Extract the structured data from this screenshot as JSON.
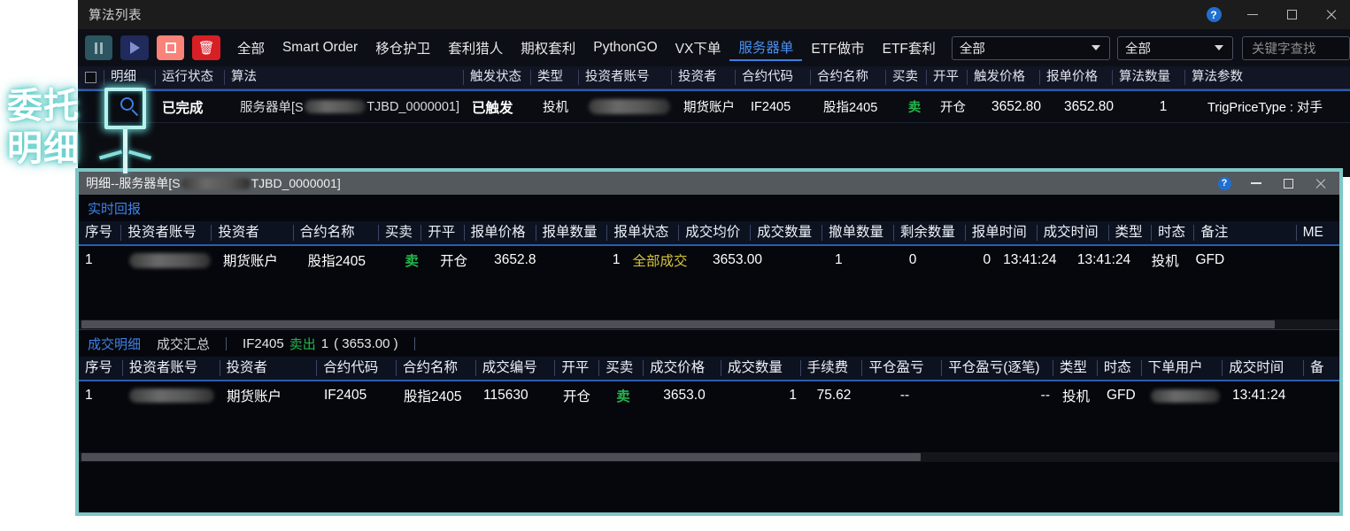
{
  "main_window": {
    "title": "算法列表",
    "window_controls": [
      "help-icon",
      "minimize-icon",
      "maximize-icon",
      "close-icon"
    ],
    "toolbar": {
      "buttons": [
        {
          "name": "pause-button",
          "icon": "pause-icon"
        },
        {
          "name": "play-button",
          "icon": "play-icon"
        },
        {
          "name": "stop-button",
          "icon": "stop-icon"
        },
        {
          "name": "delete-button",
          "icon": "trash-icon"
        }
      ],
      "tabs": [
        {
          "label": "全部",
          "active": false
        },
        {
          "label": "Smart Order",
          "active": false
        },
        {
          "label": "移仓护卫",
          "active": false
        },
        {
          "label": "套利猎人",
          "active": false
        },
        {
          "label": "期权套利",
          "active": false
        },
        {
          "label": "PythonGO",
          "active": false
        },
        {
          "label": "VX下单",
          "active": false
        },
        {
          "label": "服务器单",
          "active": true
        },
        {
          "label": "ETF做市",
          "active": false
        },
        {
          "label": "ETF套利",
          "active": false
        }
      ],
      "filter1": "全部",
      "filter2": "全部",
      "search_placeholder": "关键字查找"
    },
    "table": {
      "headers": [
        "明细",
        "运行状态",
        "算法",
        "触发状态",
        "类型",
        "投资者账号",
        "投资者",
        "合约代码",
        "合约名称",
        "买卖",
        "开平",
        "触发价格",
        "报单价格",
        "算法数量",
        "算法参数"
      ],
      "row": {
        "detail_icon": "search-icon",
        "run_status": "已完成",
        "algorithm": "服务器单[S████TJBD_0000001]",
        "trigger_status": "已触发",
        "type": "投机",
        "investor_account": "",
        "investor": "期货账户",
        "contract_code": "IF2405",
        "contract_name": "股指2405",
        "direction": "卖",
        "offset": "开仓",
        "trigger_price": "3652.80",
        "order_price": "3652.80",
        "algo_quantity": "1",
        "algo_params": "TrigPriceType : 对手"
      }
    }
  },
  "detail_window": {
    "title": "明细--服务器单[S████TJBD_0000001]",
    "window_controls": [
      "help-icon",
      "minimize-icon",
      "maximize-icon",
      "close-icon"
    ],
    "upper": {
      "tab_label": "实时回报",
      "headers": [
        "序号",
        "投资者账号",
        "投资者",
        "合约名称",
        "买卖",
        "开平",
        "报单价格",
        "报单数量",
        "报单状态",
        "成交均价",
        "成交数量",
        "撤单数量",
        "剩余数量",
        "报单时间",
        "成交时间",
        "类型",
        "时态",
        "备注",
        "ME"
      ],
      "rows": [
        {
          "seq": "1",
          "investor_account": "",
          "investor": "期货账户",
          "contract_name": "股指2405",
          "direction": "卖",
          "offset": "开仓",
          "order_price": "3652.8",
          "order_qty": "1",
          "order_status": "全部成交",
          "avg_price": "3653.00",
          "trade_qty": "1",
          "cancel_qty": "0",
          "remain_qty": "0",
          "order_time": "13:41:24",
          "trade_time": "13:41:24",
          "type": "投机",
          "tense": "GFD",
          "remark": ""
        }
      ]
    },
    "lower": {
      "tabs": [
        {
          "label": "成交明细",
          "active": true
        },
        {
          "label": "成交汇总",
          "active": false
        }
      ],
      "summary": {
        "contract": "IF2405",
        "direction": "卖出",
        "qty": "1",
        "price": "( 3653.00 )"
      },
      "headers": [
        "序号",
        "投资者账号",
        "投资者",
        "合约代码",
        "合约名称",
        "成交编号",
        "开平",
        "买卖",
        "成交价格",
        "成交数量",
        "手续费",
        "平仓盈亏",
        "平仓盈亏(逐笔)",
        "类型",
        "时态",
        "下单用户",
        "成交时间",
        "备"
      ],
      "rows": [
        {
          "seq": "1",
          "investor_account": "",
          "investor": "期货账户",
          "contract_code": "IF2405",
          "contract_name": "股指2405",
          "trade_no": "115630",
          "offset": "开仓",
          "direction": "卖",
          "trade_price": "3653.0",
          "trade_qty": "1",
          "fee": "75.62",
          "close_pl": "--",
          "close_pl_tick": "--",
          "type": "投机",
          "tense": "GFD",
          "order_user": "",
          "trade_time": "13:41:24"
        }
      ]
    }
  },
  "annotation": {
    "line1": "委托",
    "line2": "明细",
    "highlight_target": "search-icon"
  },
  "colors": {
    "accent_blue": "#3f83e8",
    "highlight_teal": "#7fc7c6",
    "sell_green": "#23b54a",
    "status_gold": "#d8c33a"
  }
}
